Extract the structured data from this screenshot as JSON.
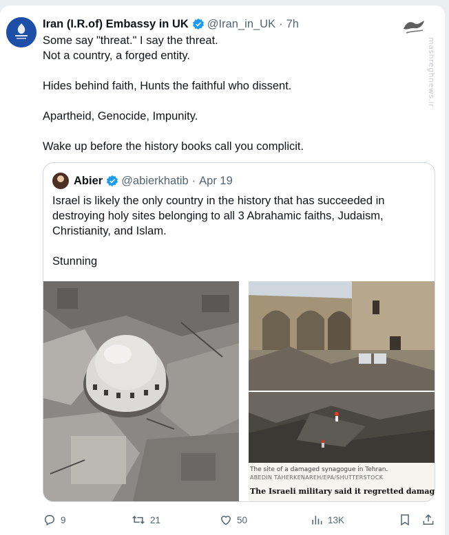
{
  "tweet": {
    "author_name": "Iran (I.R.of) Embassy in UK",
    "handle": "@Iran_in_UK",
    "separator": "·",
    "time": "7h",
    "lines": [
      "Some say \"threat.\" I say the threat.",
      "Not a country, a forged entity.",
      "Hides behind faith, Hunts the faithful who dissent.",
      "Apartheid, Genocide, Impunity.",
      "Wake up before the history books call you complicit."
    ]
  },
  "watermark": {
    "text": "mashreghnews.ir"
  },
  "quote": {
    "author_name": "Abier",
    "handle": "@abierkhatib",
    "separator": "·",
    "time": "Apr 19",
    "lines": [
      "Israel is likely the only country in the history that has succeeded in",
      "destroying holy sites belonging to all 3 Abrahamic faiths, Judaism,",
      "Christianity, and Islam.",
      "Stunning"
    ],
    "caption": {
      "line1": "The site of a damaged synagogue in Tehran.",
      "line2": "ABEDIN TAHERKENAREH/EPA/SHUTTERSTOCK",
      "line3": "The Israeli military said it regretted damage to a"
    }
  },
  "actions": {
    "replies": "9",
    "reposts": "21",
    "likes": "50",
    "views": "13K"
  },
  "colors": {
    "verified_blue": "#1d9bf0",
    "muted_text": "#536471",
    "border": "#cfd9de"
  },
  "icons": [
    "verified-badge-icon",
    "reply-icon",
    "repost-icon",
    "like-icon",
    "views-icon",
    "bookmark-icon",
    "share-icon"
  ]
}
